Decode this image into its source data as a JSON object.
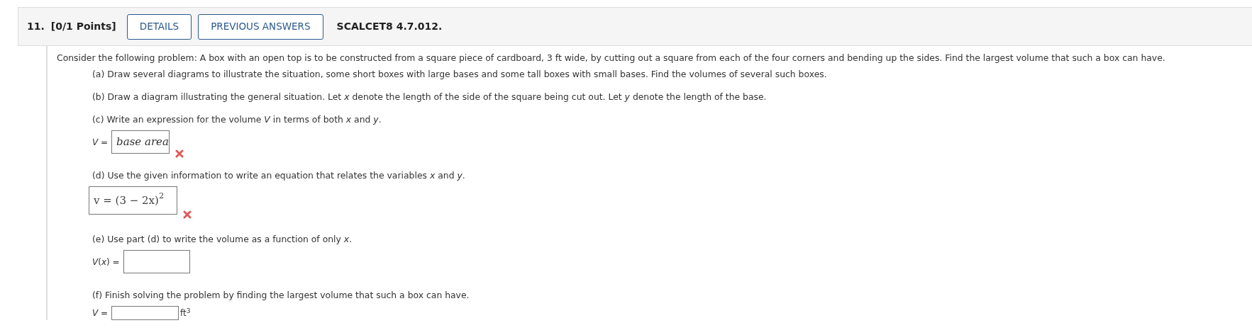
{
  "header": {
    "number": "11.",
    "points": "[0/1 Points]",
    "buttons": [
      "DETAILS",
      "PREVIOUS ANSWERS"
    ],
    "reference": "SCALCET8 4.7.012."
  },
  "intro": "Consider the following problem: A box with an open top is to be constructed from a square piece of cardboard, 3 ft wide, by cutting out a square from each of the four corners and bending up the sides. Find the largest volume that such a box can have.",
  "parts": [
    {
      "prompt": "(a) Draw several diagrams to illustrate the situation, some short boxes with large bases and some tall boxes with small bases. Find the volumes of several such boxes."
    },
    {
      "prompt": "(b) Draw a diagram illustrating the general situation. Let *x* denote the length of the side of the square being cut out. Let *y* denote the length of the base."
    },
    {
      "prompt": "(c) Write an expression for the volume *V* in terms of both *x* and *y*.",
      "answer": {
        "kind": "text",
        "label": "*V* =",
        "value": "base area",
        "incorrect": true
      }
    },
    {
      "prompt": "(d) Use the given information to write an equation that relates the variables *x* and *y*.",
      "answer": {
        "kind": "math",
        "value": "v = (3 − 2x)$^{2}$",
        "incorrect": true
      }
    },
    {
      "prompt": "(e) Use part (d) to write the volume as a function of only *x*.",
      "answer": {
        "kind": "tall",
        "label": "*V*(*x*) =",
        "incorrect": false
      }
    },
    {
      "prompt": "(f) Finish solving the problem by finding the largest volume that such a box can have.",
      "answer": {
        "kind": "short",
        "label": "*V* =",
        "unit": "ft$^{3}$",
        "incorrect": false
      }
    }
  ]
}
